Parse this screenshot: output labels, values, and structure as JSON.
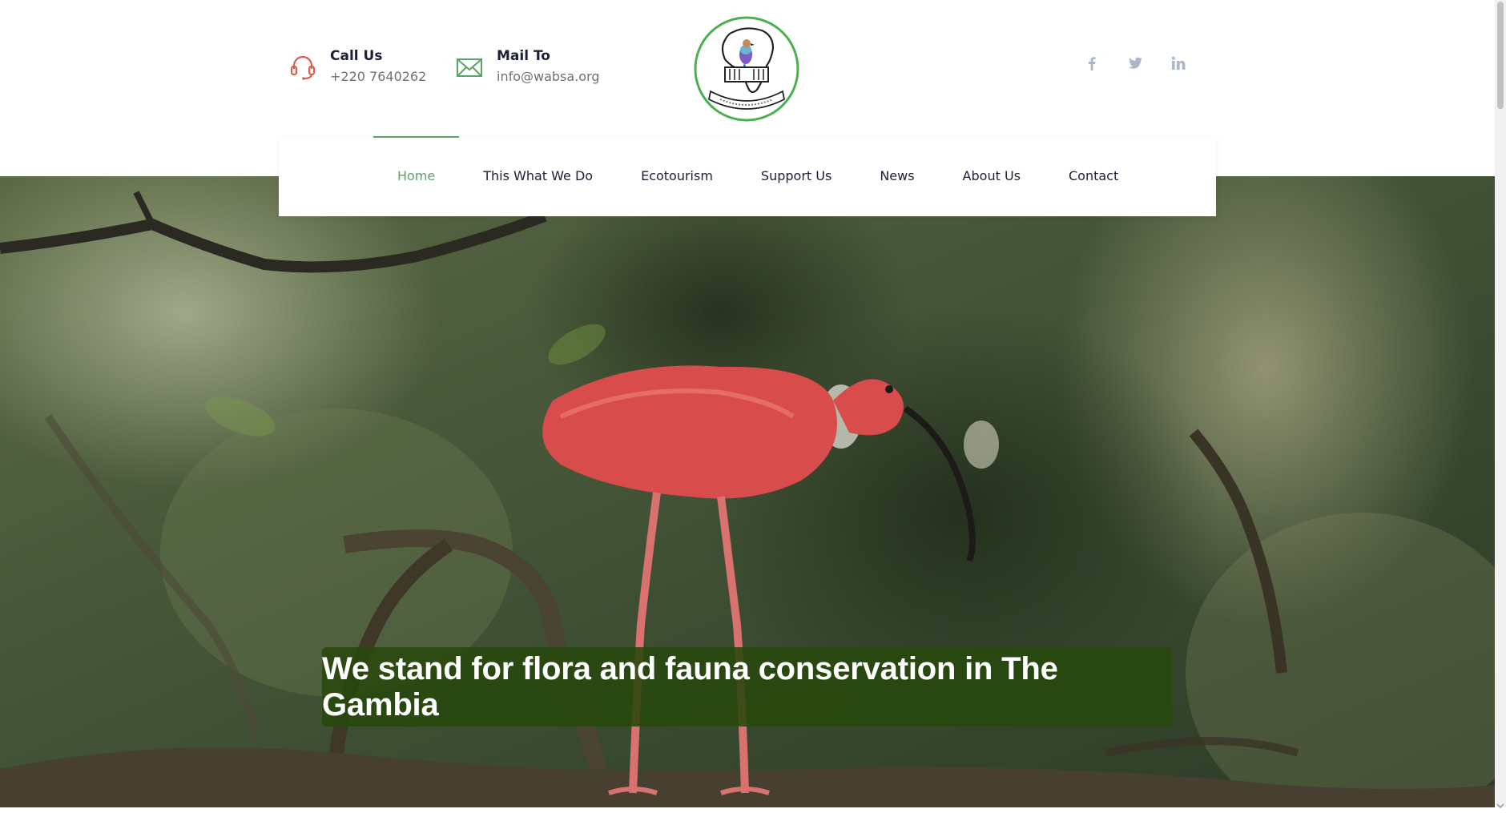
{
  "header": {
    "call": {
      "title": "Call Us",
      "value": "+220 7640262",
      "icon": "headset-icon",
      "icon_color": "#e05a4e"
    },
    "mail": {
      "title": "Mail To",
      "value": "info@wabsa.org",
      "icon": "envelope-icon",
      "icon_color": "#5aa469"
    },
    "logo": {
      "icon": "organization-logo",
      "ring_color": "#4caf50"
    },
    "social": [
      {
        "name": "facebook-icon"
      },
      {
        "name": "twitter-icon"
      },
      {
        "name": "linkedin-icon"
      }
    ]
  },
  "nav": {
    "items": [
      {
        "label": "Home",
        "active": true
      },
      {
        "label": "This What We Do"
      },
      {
        "label": "Ecotourism"
      },
      {
        "label": "Support Us"
      },
      {
        "label": "News"
      },
      {
        "label": "About Us"
      },
      {
        "label": "Contact"
      }
    ]
  },
  "hero": {
    "headline": "We stand for flora and fauna conservation in The Gambia",
    "image": "scarlet-ibis-on-branch"
  },
  "colors": {
    "accent": "#5aa469",
    "text_dark": "#1c1f35",
    "headline_bg": "#28480c"
  }
}
